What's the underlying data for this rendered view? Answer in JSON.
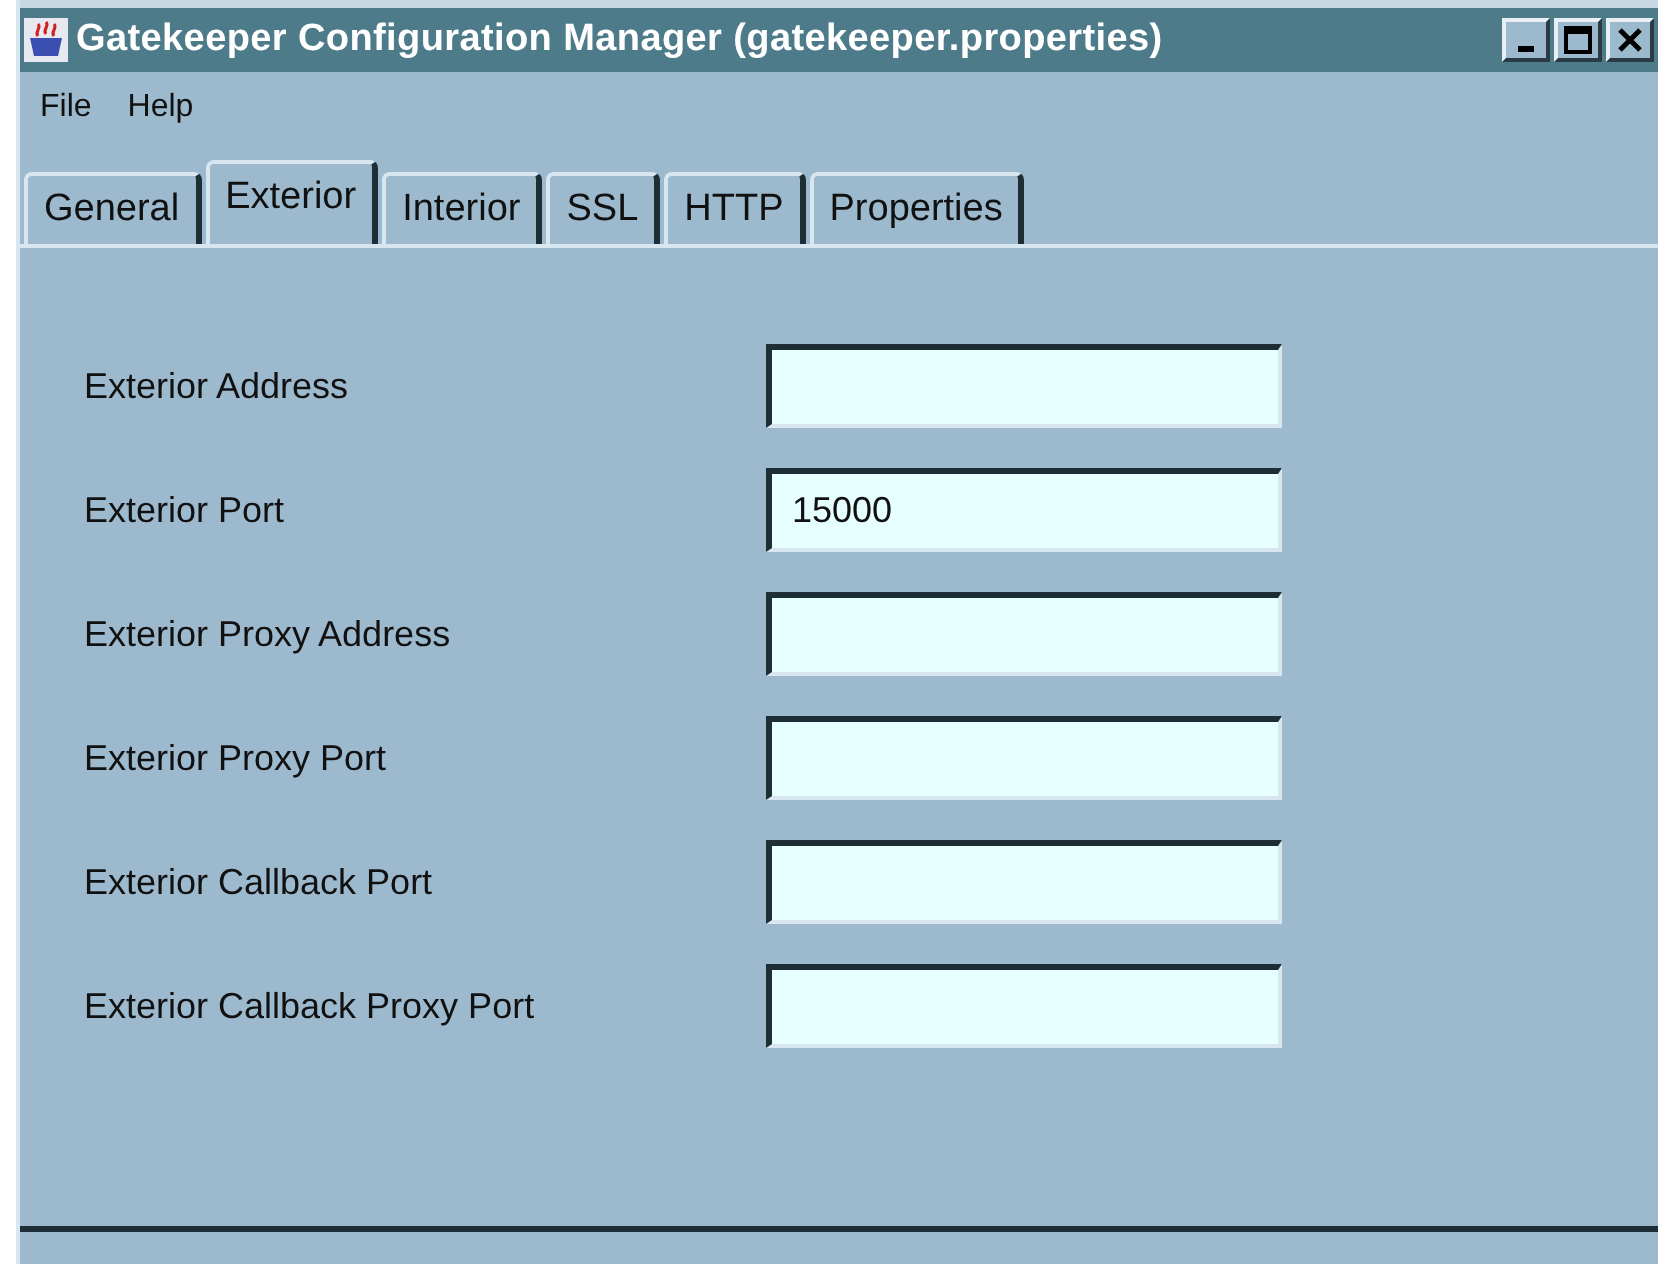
{
  "window": {
    "title": "Gatekeeper Configuration Manager (gatekeeper.properties)"
  },
  "menu": [
    "File",
    "Help"
  ],
  "tabs": [
    {
      "label": "General",
      "selected": false
    },
    {
      "label": "Exterior",
      "selected": true
    },
    {
      "label": "Interior",
      "selected": false
    },
    {
      "label": "SSL",
      "selected": false
    },
    {
      "label": "HTTP",
      "selected": false
    },
    {
      "label": "Properties",
      "selected": false
    }
  ],
  "fields": [
    {
      "label": "Exterior Address"
    },
    {
      "label": "Exterior Port",
      "value": "15000"
    },
    {
      "label": "Exterior Proxy Address"
    },
    {
      "label": "Exterior Proxy Port"
    },
    {
      "label": "Exterior Callback Port"
    },
    {
      "label": "Exterior Callback Proxy Port"
    }
  ]
}
